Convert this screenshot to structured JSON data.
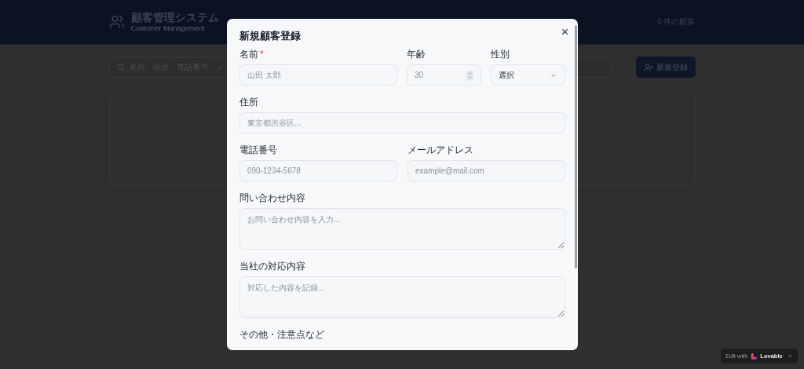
{
  "header": {
    "title": "顧客管理システム",
    "subtitle": "Customer Management",
    "customer_count": "0 件の顧客"
  },
  "search": {
    "placeholder": "名前、住所、電話番号、メ"
  },
  "new_button": {
    "label": "新規登録"
  },
  "dialog": {
    "title": "新規顧客登録",
    "rows": [
      {
        "fields": [
          {
            "kind": "text",
            "label": "名前",
            "required_mark": "*",
            "placeholder": "山田 太郎"
          },
          {
            "kind": "number",
            "label": "年齢",
            "placeholder": "30"
          },
          {
            "kind": "select",
            "label": "性別",
            "value": "選択"
          }
        ]
      },
      {
        "fields": [
          {
            "kind": "text",
            "label": "住所",
            "placeholder": "東京都渋谷区..."
          }
        ]
      },
      {
        "fields": [
          {
            "kind": "text",
            "label": "電話番号",
            "placeholder": "090-1234-5678"
          },
          {
            "kind": "text",
            "label": "メールアドレス",
            "placeholder": "example@mail.com"
          }
        ]
      },
      {
        "fields": [
          {
            "kind": "textarea",
            "label": "問い合わせ内容",
            "placeholder": "お問い合わせ内容を入力..."
          }
        ]
      },
      {
        "fields": [
          {
            "kind": "textarea",
            "label": "当社の対応内容",
            "placeholder": "対応した内容を記録..."
          }
        ]
      },
      {
        "fields": [
          {
            "kind": "label",
            "label": "その他・注意点など"
          }
        ]
      }
    ]
  },
  "badge": {
    "text": "Edit with",
    "brand": "Lovable"
  }
}
